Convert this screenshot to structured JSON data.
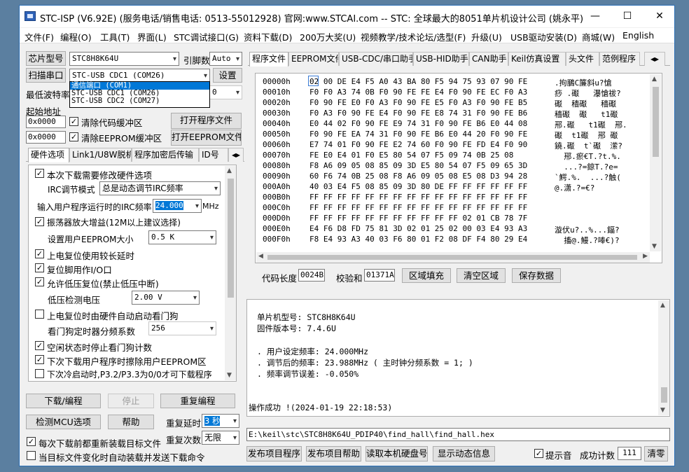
{
  "window": {
    "title": "STC-ISP (V6.92E) (服务电话/销售电话: 0513-55012928) 官网:www.STCAI.com  -- STC: 全球最大的8051单片机设计公司 (姚永平)",
    "minimize": "—",
    "maximize": "☐",
    "close": "✕"
  },
  "menu": [
    "文件(F)",
    "编程(O)",
    "工具(T)",
    "界面(L)",
    "STC调试接口(G)",
    "资料下载(D)",
    "200万大奖(U)",
    "视频教学/技术论坛/选型(F)",
    "升级(U)",
    "USB驱动安装(D)",
    "商城(W)",
    "English"
  ],
  "left": {
    "chip_label": "芯片型号",
    "chip_value": "STC8H8K64U",
    "pins_label": "引脚数",
    "pins_value": "Auto",
    "scan_button": "扫描串口",
    "port_value": "STC-USB CDC1 (COM26)",
    "settings_button": "设置",
    "port_options": [
      "通信端口 (COM1)",
      "STC-USB CDC1 (COM26)",
      "STC-USB CDC2 (COM27)"
    ],
    "baud_label": "最低波特率",
    "baud_value": "0",
    "start_addr_label": "起始地址",
    "addr1": "0x0000",
    "clear_code": "清除代码缓冲区",
    "open_prog": "打开程序文件",
    "addr2": "0x0000",
    "clear_eeprom": "清除EEPROM缓冲区",
    "open_eeprom": "打开EEPROM文件",
    "tabs": [
      "硬件选项",
      "Link1/U8W脱机",
      "程序加密后传输",
      "ID号"
    ],
    "options": {
      "modify_hw": "本次下载需要修改硬件选项",
      "irc_mode_label": "IRC调节模式",
      "irc_mode_value": "总是动态调节IRC频率",
      "irc_freq_label": "输入用户程序运行时的IRC频率",
      "irc_freq_value": "24.000",
      "irc_unit": "MHz",
      "osc_gain": "振荡器放大增益(12M以上建议选择)",
      "eeprom_size_label": "设置用户EEPROM大小",
      "eeprom_size_value": "0.5 K",
      "long_reset": "上电复位使用较长延时",
      "reset_pin_io": "复位脚用作I/O口",
      "lvd_reset": "允许低压复位(禁止低压中断)",
      "lvd_voltage_label": "低压检测电压",
      "lvd_voltage_value": "2.00 V",
      "wdt_auto": "上电复位时由硬件自动启动看门狗",
      "wdt_div_label": "看门狗定时器分频系数",
      "wdt_div_value": "256",
      "idle_stop_wdt": "空闲状态时停止看门狗计数",
      "erase_eeprom": "下次下载用户程序时擦除用户EEPROM区",
      "p32_p33": "下次冷启动时,P3.2/P3.3为0/0才可下载程序"
    },
    "download_button": "下载/编程",
    "stop_button": "停止",
    "reprogram_button": "重复编程",
    "check_mcu_button": "检测MCU选项",
    "help_button": "帮助",
    "retry_delay_label": "重复延时",
    "retry_delay_value": "3 秒",
    "reload_before_download": "每次下载前都重新装载目标文件",
    "retry_count_label": "重复次数",
    "retry_count_value": "无限",
    "auto_load_send": "当目标文件变化时自动装载并发送下载命令"
  },
  "right": {
    "tabs": [
      "程序文件",
      "EEPROM文件",
      "USB-CDC/串口助手",
      "USB-HID助手",
      "CAN助手",
      "Keil仿真设置",
      "头文件",
      "范例程序"
    ],
    "hex_rows": [
      {
        "addr": "00000h",
        "bytes": "02 00 DE E4 F5 A0 43 BA 80 F5 94 75 93 07 90 FE",
        "ascii": ".拘鵩C簾斜u?愴"
      },
      {
        "addr": "00010h",
        "bytes": "F0 F0 A3 74 0B F0 90 FE FE E4 F0 90 FE EC F0 A3",
        "ascii": "痧 .礟   瀑愴祓?"
      },
      {
        "addr": "00020h",
        "bytes": "F0 90 FE E0 F0 A3 F0 90 FE E5 F0 A3 F0 90 FE B5",
        "ascii": "礟  穑礟   穑礟"
      },
      {
        "addr": "00030h",
        "bytes": "F0 A3 F0 90 FE E4 F0 90 FE E8 74 31 F0 90 FE B6",
        "ascii": "穑礟  礟   t1礟"
      },
      {
        "addr": "00040h",
        "bytes": "E0 44 02 F0 90 FE E9 74 31 F0 90 FE B6 E0 44 08",
        "ascii": "郉.礟   t1礟  郉."
      },
      {
        "addr": "00050h",
        "bytes": "F0 90 FE EA 74 31 F0 90 FE B6 E0 44 20 F0 90 FE",
        "ascii": "礟  t1礟  郉 礟"
      },
      {
        "addr": "00060h",
        "bytes": "E7 74 01 F0 90 FE E2 74 60 F0 90 FE FD E4 F0 90",
        "ascii": "鐃.礟  t`礟  潆?"
      },
      {
        "addr": "00070h",
        "bytes": "FE E0 E4 01 F0 E5 80 54 07 F5 09 74 0B 25 08",
        "ascii": "  郉.瘀€T.?t.%."
      },
      {
        "addr": "00080h",
        "bytes": "F8 A6 09 05 08 85 09 3D E5 80 54 07 F5 09 65 3D",
        "ascii": "  ...?=鍄T.?e="
      },
      {
        "addr": "00090h",
        "bytes": "60 F6 74 0B 25 08 F8 A6 09 05 08 E5 08 D3 94 28",
        "ascii": "`鰐.%.  ...?触("
      },
      {
        "addr": "000A0h",
        "bytes": "40 03 E4 F5 08 85 09 3D 80 DE FF FF FF FF FF FF",
        "ascii": "@.潇.?=€?"
      },
      {
        "addr": "000B0h",
        "bytes": "FF FF FF FF FF FF FF FF FF FF FF FF FF FF FF FF",
        "ascii": ""
      },
      {
        "addr": "000C0h",
        "bytes": "FF FF FF FF FF FF FF FF FF FF FF FF FF FF FF FF",
        "ascii": ""
      },
      {
        "addr": "000D0h",
        "bytes": "FF FF FF FF FF FF FF FF FF FF FF 02 01 CB 78 7F",
        "ascii": ""
      },
      {
        "addr": "000E0h",
        "bytes": "E4 F6 D8 FD 75 81 3D 02 01 25 02 00 03 E4 93 A3",
        "ascii": "漩伏u?..%...鍢?"
      },
      {
        "addr": "000F0h",
        "bytes": "F8 E4 93 A3 40 03 F6 80 01 F2 08 DF F4 80 29 E4",
        "ascii": "  搐@.鰻.?唪€)?"
      }
    ],
    "code_len_label": "代码长度",
    "code_len_value": "0024B",
    "checksum_label": "校验和",
    "checksum_value": "01371A",
    "fill_button": "区域填充",
    "clear_button": "清空区域",
    "save_button": "保存数据",
    "info_lines": [
      "单片机型号: STC8H8K64U",
      "固件版本号: 7.4.6U",
      "",
      "",
      ". 用户设定频率: 24.000MHz",
      ". 调节后的频率: 23.988MHz ( 主时钟分频系数 = 1; )",
      ". 频率调节误差: -0.050%",
      "",
      "",
      "",
      "操作成功 !(2024-01-19 22:18:53)"
    ],
    "file_path": "E:\\keil\\stc\\STC8H8K64U_PDIP40\\find_hall\\find_hall.hex",
    "publish_prog": "发布项目程序",
    "publish_help": "发布项目帮助",
    "read_disk": "读取本机硬盘号",
    "show_dynamic": "显示动态信息",
    "beep_label": "提示音",
    "success_count_label": "成功计数",
    "success_count_value": "111",
    "reset_button": "清零"
  }
}
